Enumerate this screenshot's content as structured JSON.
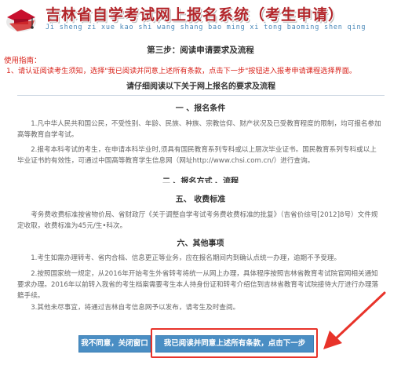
{
  "header": {
    "site_title": "吉林省自学考试网上报名系统（考生申请）",
    "pinyin": "Ji  sheng  zi  xue  kao  shi  wang  shang  bao  ming  xi  tong  baoming  shen  qing"
  },
  "step_title": "第三步：阅读申请要求及流程",
  "guide": {
    "label": "使用指南：",
    "text": "1、请认证阅读考生须知，选择\"我已阅读并同意上述所有条款，点击下一步\"按钮进入报考申请课程选择界面。"
  },
  "panel_title": "请仔细阅读以下关于网上报名的要求及流程",
  "sections": {
    "s1": {
      "title": "一 、报名条件",
      "p1": "1.凡中华人民共和国公民，不受性别、年龄、民族、种族、宗教信仰、财产状况及已受教育程度的限制，均可报名参加高等教育自学考试。",
      "p2": "2.报考本科考试的考生，在申请本科毕业时,须具有国民教育系列专科或以上层次毕业证书。国民教育系列专科或以上毕业证书的有效性，可通过中国高等教育学生信息网（网址http://www.chsi.com.cn/）进行查询。"
    },
    "cutoff_title": "二 、报名方式 、流程",
    "s5": {
      "title": "五、 收费标准",
      "p1": "考务费收费标准按省物价局、省财政厅《关于调整自学考试考务费收费标准的批复》（吉省价综号[2012]8号）文件规定收取，收费标准为45元/生•科次。"
    },
    "s6": {
      "title": "六、其他事项",
      "p1": "1.考生如需办理转考、省内合档、信息更正等业务，应在报名期间内到确认点统一办理，逾期不予受理。",
      "p2": "2.按照国家统一规定，从2016年开始考生外省转考将统一从网上办理，具体程序按照吉林省教育考试院官网相关通知要求办理。2016年以前转入我省的考生档案需要考生本人持身份证和转考介绍信到吉林省教育考试院接待大厅进行办理落籍手续。",
      "p3": "3.其他未尽事宜，将通过吉林自考信息网予以发布，请考生及时查阅。"
    }
  },
  "buttons": {
    "disagree": "我不同意，关闭窗口",
    "agree": "我已阅读并同意上述所有条款，点击下一步"
  },
  "colors": {
    "brand_red": "#b3262b",
    "guide_red": "#d9241c",
    "button_blue": "#4a8ec4",
    "annotation_red": "#e8332a"
  }
}
